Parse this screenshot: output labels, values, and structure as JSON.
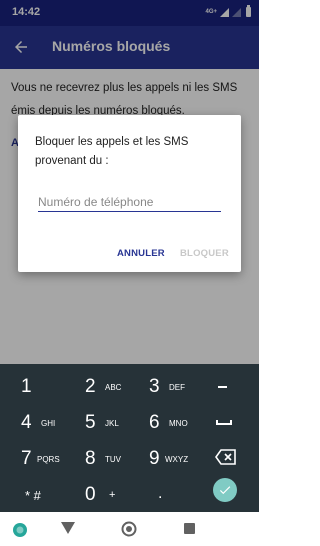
{
  "status_bar": {
    "time": "14:42",
    "network": "4G+"
  },
  "app_bar": {
    "title": "Numéros bloqués"
  },
  "content": {
    "info_text": "Vous ne recevrez plus les appels ni les SMS émis depuis les numéros bloqués.",
    "add_link": "A"
  },
  "dialog": {
    "title": "Bloquer les appels et les SMS provenant du :",
    "input_placeholder": "Numéro de téléphone",
    "input_value": "",
    "cancel_label": "ANNULER",
    "block_label": "BLOQUER"
  },
  "keypad": {
    "rows": [
      [
        {
          "digit": "1",
          "letters": ""
        },
        {
          "digit": "2",
          "letters": "ABC"
        },
        {
          "digit": "3",
          "letters": "DEF"
        }
      ],
      [
        {
          "digit": "4",
          "letters": "GHI"
        },
        {
          "digit": "5",
          "letters": "JKL"
        },
        {
          "digit": "6",
          "letters": "MNO"
        }
      ],
      [
        {
          "digit": "7",
          "letters": "PQRS"
        },
        {
          "digit": "8",
          "letters": "TUV"
        },
        {
          "digit": "9",
          "letters": "WXYZ"
        }
      ]
    ],
    "star_hash": "* #",
    "zero": "0",
    "plus": "+",
    "period": "."
  },
  "colors": {
    "status_bar": "#1a237e",
    "app_bar": "#283593",
    "accent": "#283593",
    "keypad_bg": "#263238",
    "done_button": "#80cbc4",
    "nav_home_dot": "#26a69a"
  },
  "icons": {
    "back": "arrow-back-icon",
    "backspace": "backspace-icon",
    "done": "check-icon",
    "space": "space-icon",
    "minus": "minus-icon",
    "nav_back": "triangle-back-icon",
    "nav_home": "circle-home-icon",
    "nav_recents": "square-recents-icon",
    "keyboard_switch": "keyboard-switch-icon"
  }
}
